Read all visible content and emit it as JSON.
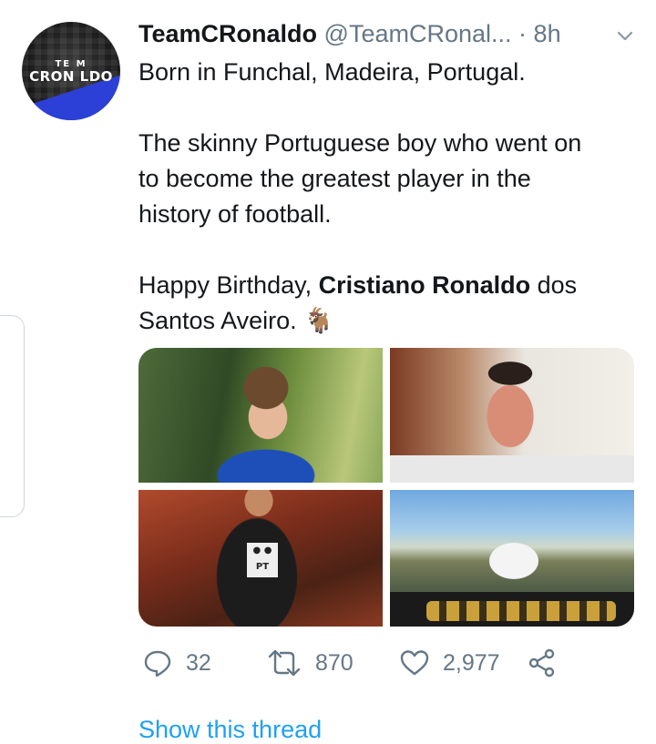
{
  "tweet": {
    "author_name": "TeamCRonaldo",
    "author_handle": "@TeamCRonal...",
    "separator": "·",
    "time": "8h",
    "avatar_text_top": "TE  M",
    "avatar_text_bottom": "CRON LDO",
    "text_line1": "Born in Funchal, Madeira, Portugal.",
    "text_para2": "The skinny Portuguese boy who went on\nto become the greatest player in the\nhistory of football.",
    "text_para3_start": "Happy Birthday, ",
    "text_para3_bold": "Cristiano Ronaldo",
    "text_para3_end": " dos\nSantos Aveiro. ",
    "emoji": "🐐",
    "photo_jersey_text": "PT",
    "stats": {
      "replies": "32",
      "retweets": "870",
      "likes": "2,977"
    },
    "show_thread_label": "Show this thread"
  },
  "icons": [
    "chevron-down-icon",
    "reply-icon",
    "retweet-icon",
    "like-icon",
    "share-icon"
  ],
  "colors": {
    "link": "#1da1f2",
    "muted": "#657786",
    "text": "#14171a"
  }
}
